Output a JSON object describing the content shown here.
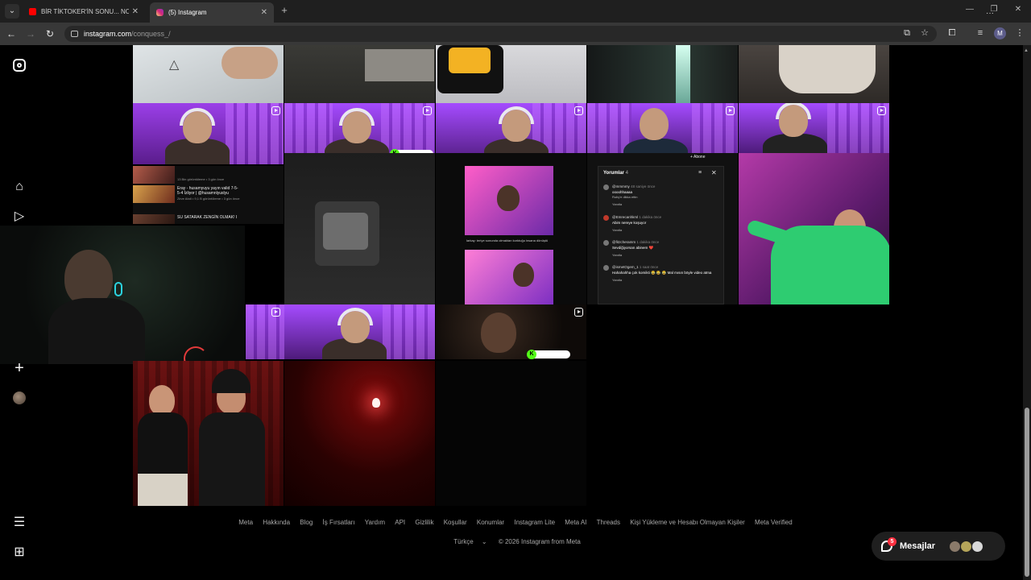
{
  "browser": {
    "tabs": [
      {
        "title": "BİR TİKTOKER'İN SONU... NORM",
        "favicon": "youtube-icon",
        "active": false
      },
      {
        "title": "(5) Instagram",
        "favicon": "instagram-icon",
        "active": true
      }
    ],
    "url_host": "instagram.com",
    "url_path": "/conquess_/",
    "profile_initial": "M"
  },
  "sidebar": {
    "items": [
      "instagram-logo",
      "home-icon",
      "reels-icon",
      "create-icon",
      "profile-avatar",
      "menu-icon",
      "apps-icon"
    ]
  },
  "embeds": {
    "youtube_list": [
      {
        "title": "",
        "meta": "13 Bin görüntüleme • 3 gün önce"
      },
      {
        "title": "Eray - husamyuyu yayın valid 7-5-5-4 İzliyor | @husamnlyuslyu",
        "meta": "Zirve Abdi • 9,1 B görüntüleme • 3 gün önce"
      },
      {
        "title": "SU SATARAK ZENGİN OLMAK! I",
        "meta": ""
      }
    ],
    "chat_line": "larkay: teriye sonunda olmaktan korktuğu insana dönüştü",
    "k_badge_1": "KICK",
    "k_badge_2": "KICK"
  },
  "comments_panel": {
    "header": "Yorumlar",
    "count": "4",
    "items": [
      {
        "user": "@mmmmy",
        "time": "48 saniye önce",
        "text": "oooohhaaaa",
        "sub": "Ruby'e dikka ettin"
      },
      {
        "user": "@Emrecanhkml",
        "time": "1 dakika önce",
        "text": "Abim nereye koşuyor",
        "sub": ""
      },
      {
        "user": "@fitzcheramm",
        "time": "1 dakika önce",
        "text": "Sevdiğiyorsan abinem ❤️",
        "sub": ""
      },
      {
        "user": "@ismetOgem_1",
        "time": "1 saat önce",
        "text": "Hahahahha çok komikti 😂 😂 😂 Mal mısın böyle video atma",
        "sub": ""
      }
    ],
    "reply_label": "Yanıtla"
  },
  "footer": {
    "links": [
      "Meta",
      "Hakkında",
      "Blog",
      "İş Fırsatları",
      "Yardım",
      "API",
      "Gizlilik",
      "Koşullar",
      "Konumlar",
      "Instagram Lite",
      "Meta AI",
      "Threads",
      "Kişi Yükleme ve Hesabı Olmayan Kişiler",
      "Meta Verified"
    ],
    "language": "Türkçe",
    "copyright": "© 2026 Instagram from Meta"
  },
  "messages": {
    "label": "Mesajlar",
    "badge": "5"
  },
  "colors": {
    "accent_red": "#ff3040",
    "neon_purple": "#a54bff",
    "background": "#000000"
  }
}
